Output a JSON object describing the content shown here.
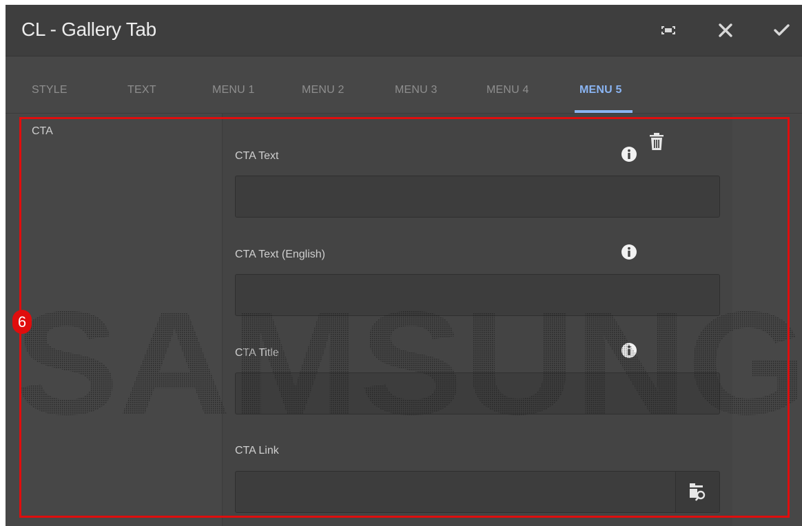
{
  "dialog": {
    "title": "CL - Gallery Tab",
    "header_buttons": [
      {
        "name": "fullscreen-icon"
      },
      {
        "name": "close-icon"
      },
      {
        "name": "checkmark-icon"
      }
    ]
  },
  "tabs": [
    {
      "label": "STYLE",
      "active": false
    },
    {
      "label": "TEXT",
      "active": false
    },
    {
      "label": "MENU 1",
      "active": false
    },
    {
      "label": "MENU 2",
      "active": false
    },
    {
      "label": "MENU 3",
      "active": false
    },
    {
      "label": "MENU 4",
      "active": false
    },
    {
      "label": "MENU 5",
      "active": true
    }
  ],
  "section": {
    "label": "CTA"
  },
  "fields": [
    {
      "label": "CTA Text",
      "value": "",
      "icon": "info-icon"
    },
    {
      "label": "CTA Text (English)",
      "value": "",
      "icon": "info-icon"
    },
    {
      "label": "CTA Title",
      "value": "",
      "icon": "info-icon"
    },
    {
      "label": "CTA Link",
      "value": "",
      "icon": "folder-search-icon"
    }
  ],
  "watermark": "SAMSUNG",
  "annotation": {
    "badge": "6"
  },
  "colors": {
    "accent": "#8ab4f2",
    "highlight": "#e00d0d",
    "header_bg": "#3e3e3e",
    "panel_bg": "#474747"
  }
}
